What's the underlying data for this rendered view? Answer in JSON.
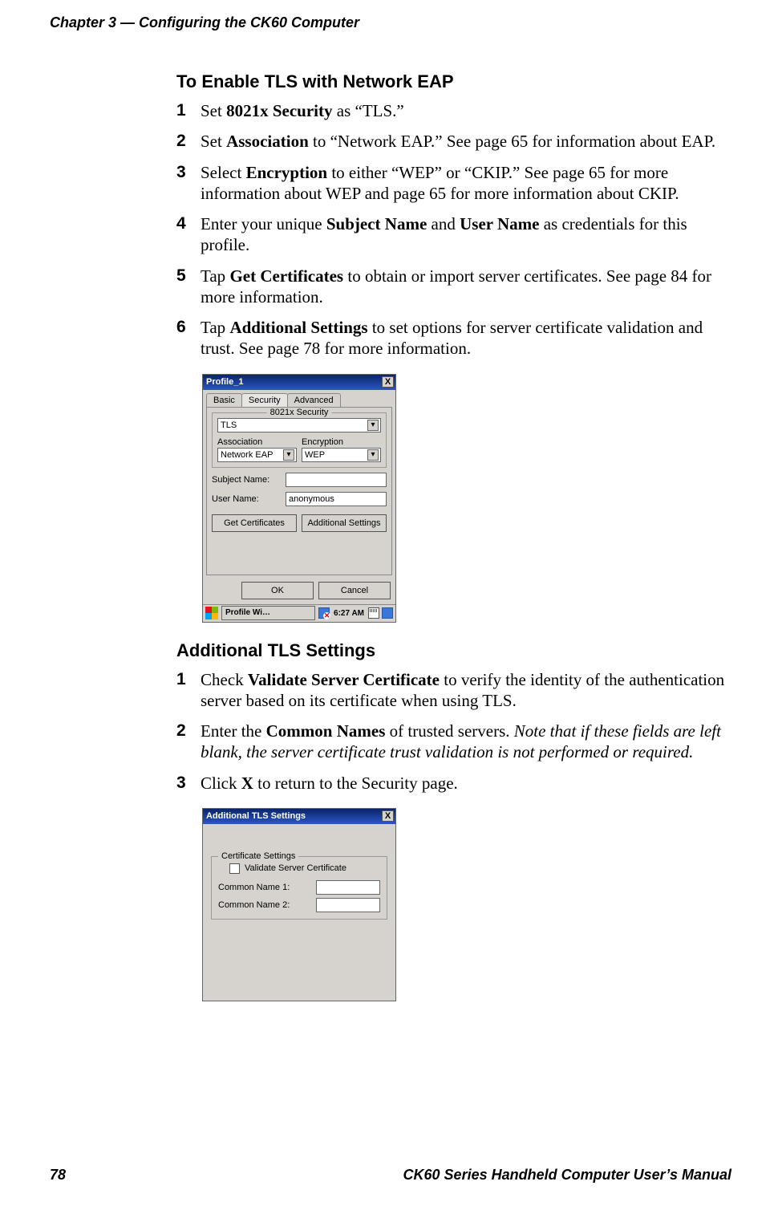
{
  "header": {
    "chapter_line": "Chapter 3 — Configuring the CK60 Computer"
  },
  "section1": {
    "heading": "To Enable TLS with Network EAP",
    "steps": [
      {
        "n": "1",
        "pre": "Set ",
        "bold": "8021x Security",
        "post": " as “TLS.”"
      },
      {
        "n": "2",
        "pre": "Set ",
        "bold": "Association",
        "post": " to “Network EAP.” See page 65 for information about EAP."
      },
      {
        "n": "3",
        "pre": "Select ",
        "bold": "Encryption",
        "post": " to either “WEP” or “CKIP.” See page 65 for more information about WEP and page 65 for more information about CKIP."
      },
      {
        "n": "4",
        "pre": "Enter your unique ",
        "bold": "Subject Name",
        "mid": " and ",
        "bold2": "User Name",
        "post": " as credentials for this profile."
      },
      {
        "n": "5",
        "pre": "Tap ",
        "bold": "Get Certificates",
        "post": " to obtain or import server certificates. See page 84 for more information."
      },
      {
        "n": "6",
        "pre": "Tap ",
        "bold": "Additional Settings",
        "post": " to set options for server certificate validation and trust. See page 78 for more information."
      }
    ]
  },
  "profile_window": {
    "title": "Profile_1",
    "close": "X",
    "tabs": [
      "Basic",
      "Security",
      "Advanced"
    ],
    "active_tab_index": 1,
    "security_legend": "8021x Security",
    "security_value": "TLS",
    "assoc_label": "Association",
    "assoc_value": "Network EAP",
    "enc_label": "Encryption",
    "enc_value": "WEP",
    "subject_label": "Subject Name:",
    "subject_value": "",
    "user_label": "User Name:",
    "user_value": "anonymous",
    "btn_get_cert": "Get Certificates",
    "btn_addl": "Additional Settings",
    "ok": "OK",
    "cancel": "Cancel",
    "taskbar_app": "Profile Wi…",
    "clock": "6:27 AM"
  },
  "section2": {
    "heading": "Additional TLS Settings",
    "step1": {
      "n": "1",
      "pre": "Check ",
      "bold": "Validate Server Certificate",
      "post": " to verify the identity of the authenti­cation server based on its certificate when using TLS."
    },
    "step2": {
      "n": "2",
      "pre": "Enter the ",
      "bold": "Common Names",
      "post_plain": " of trusted servers. ",
      "post_italic": "Note that if these fields are left blank, the server certificate trust validation is not performed or required."
    },
    "step3": {
      "n": "3",
      "pre": "Click ",
      "bold": "X",
      "post": " to return to the Security page."
    }
  },
  "tls_window": {
    "title": "Additional TLS Settings",
    "close": "X",
    "cert_legend": "Certificate Settings",
    "validate_label": "Validate Server Certificate",
    "cn1_label": "Common Name 1:",
    "cn1_value": "",
    "cn2_label": "Common Name 2:",
    "cn2_value": ""
  },
  "footer": {
    "page_number": "78",
    "manual_title": "CK60 Series Handheld Computer User’s Manual"
  }
}
